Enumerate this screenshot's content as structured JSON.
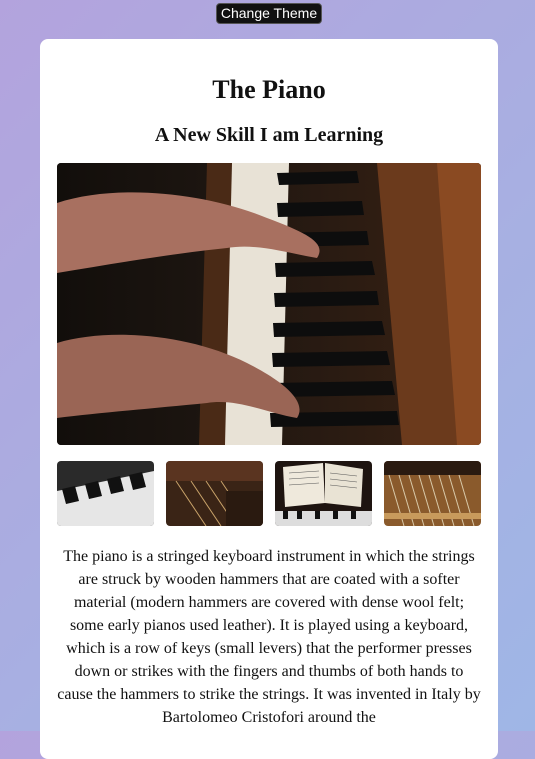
{
  "header": {
    "theme_button_label": "Change Theme"
  },
  "article": {
    "title": "The Piano",
    "subtitle": "A New Skill I am Learning",
    "body": "The piano is a stringed keyboard instrument in which the strings are struck by wooden hammers that are coated with a softer material (modern hammers are covered with dense wool felt; some early pianos used leather). It is played using a keyboard, which is a row of keys (small levers) that the performer presses down or strikes with the fingers and thumbs of both hands to cause the hammers to strike the strings. It was invented in Italy by Bartolomeo Cristofori around the"
  },
  "gallery": {
    "hero": "hands-playing-piano-photo",
    "thumbnails": [
      "piano-keys-closeup-photo",
      "piano-interior-photo",
      "sheet-music-on-piano-photo",
      "piano-strings-photo"
    ]
  }
}
